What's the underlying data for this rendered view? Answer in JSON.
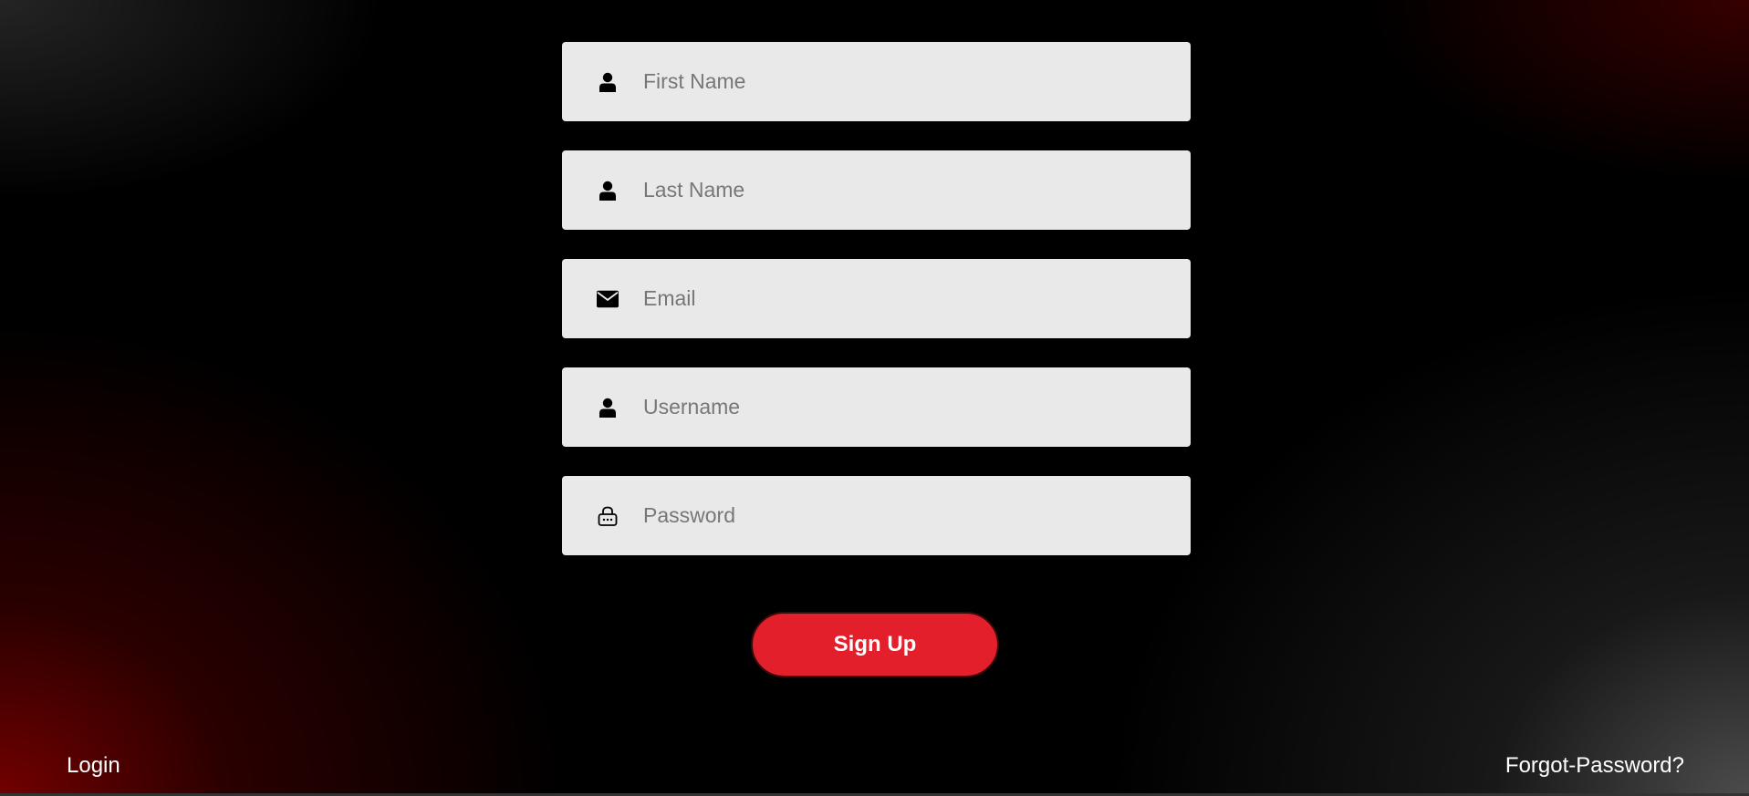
{
  "form": {
    "fields": [
      {
        "icon": "user-icon",
        "placeholder": "First Name",
        "value": ""
      },
      {
        "icon": "user-icon",
        "placeholder": "Last Name",
        "value": ""
      },
      {
        "icon": "envelope-icon",
        "placeholder": "Email",
        "value": ""
      },
      {
        "icon": "user-icon",
        "placeholder": "Username",
        "value": ""
      },
      {
        "icon": "lock-icon",
        "placeholder": "Password",
        "value": ""
      }
    ],
    "submit_label": "Sign Up"
  },
  "links": {
    "login": "Login",
    "forgot_password": "Forgot-Password?"
  },
  "colors": {
    "accent": "#e21f2a",
    "field_bg": "#e9e9e9",
    "page_bg": "#000000"
  }
}
